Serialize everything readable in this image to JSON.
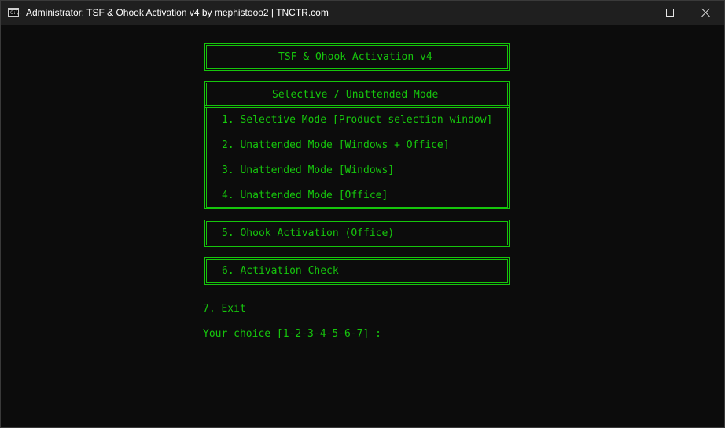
{
  "window": {
    "title": "Administrator:  TSF & Ohook Activation v4 by mephistooo2 | TNCTR.com",
    "icon_label": "C:\\."
  },
  "console": {
    "header": "TSF & Ohook Activation v4",
    "selective_heading": "Selective / Unattended Mode",
    "options": [
      "1. Selective Mode [Product selection window]",
      "2. Unattended Mode [Windows + Office]",
      "3. Unattended Mode [Windows]",
      "4. Unattended Mode [Office]"
    ],
    "ohook_option": "5. Ohook Activation (Office)",
    "check_option": "6. Activation Check",
    "exit_option": "7. Exit",
    "prompt": "Your choice [1-2-3-4-5-6-7] :"
  },
  "colors": {
    "text": "#16c60c",
    "background": "#0c0c0c",
    "titlebar": "#1f1f1f"
  },
  "icons": [
    "console-app-icon",
    "minimize-icon",
    "maximize-icon",
    "close-icon"
  ]
}
